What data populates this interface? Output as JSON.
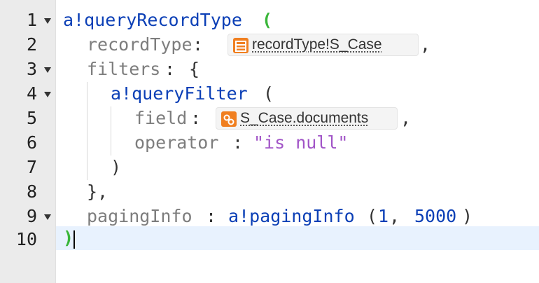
{
  "editor": {
    "line_numbers": [
      "1",
      "2",
      "3",
      "4",
      "5",
      "6",
      "7",
      "8",
      "9",
      "10"
    ],
    "lines": {
      "l1": {
        "fn": "a!queryRecordType",
        "open": "("
      },
      "l2": {
        "param": "recordType",
        "sep": ":",
        "after": ","
      },
      "l3": {
        "param": "filters",
        "sep": ":",
        "brace": "{"
      },
      "l4": {
        "fn": "a!queryFilter",
        "open": "("
      },
      "l5": {
        "param": "field",
        "sep": ":",
        "after": ","
      },
      "l6": {
        "param": "operator",
        "sep": ":",
        "string": "\"is null\""
      },
      "l7": {
        "close": ")"
      },
      "l8": {
        "close": "},"
      },
      "l9": {
        "param": "pagingInfo",
        "sep": ":",
        "fn": "a!pagingInfo",
        "open": "(",
        "arg1": "1",
        "comma": ",",
        "arg2": "5000",
        "close": ")"
      },
      "l10": {
        "close": ")"
      }
    },
    "tokens": {
      "record_type": {
        "label": "recordType!S_Case",
        "icon": "record-type-icon",
        "color": "#f07f20"
      },
      "field": {
        "label": "S_Case.documents",
        "icon": "relationship-link-icon",
        "color": "#f07f20"
      }
    },
    "colors": {
      "function": "#0b3fb6",
      "parameter": "#7d7d7d",
      "string": "#a154c7",
      "matched_paren": "#39b639",
      "active_line": "#e8f2fe",
      "gutter": "#ebebeb"
    }
  }
}
